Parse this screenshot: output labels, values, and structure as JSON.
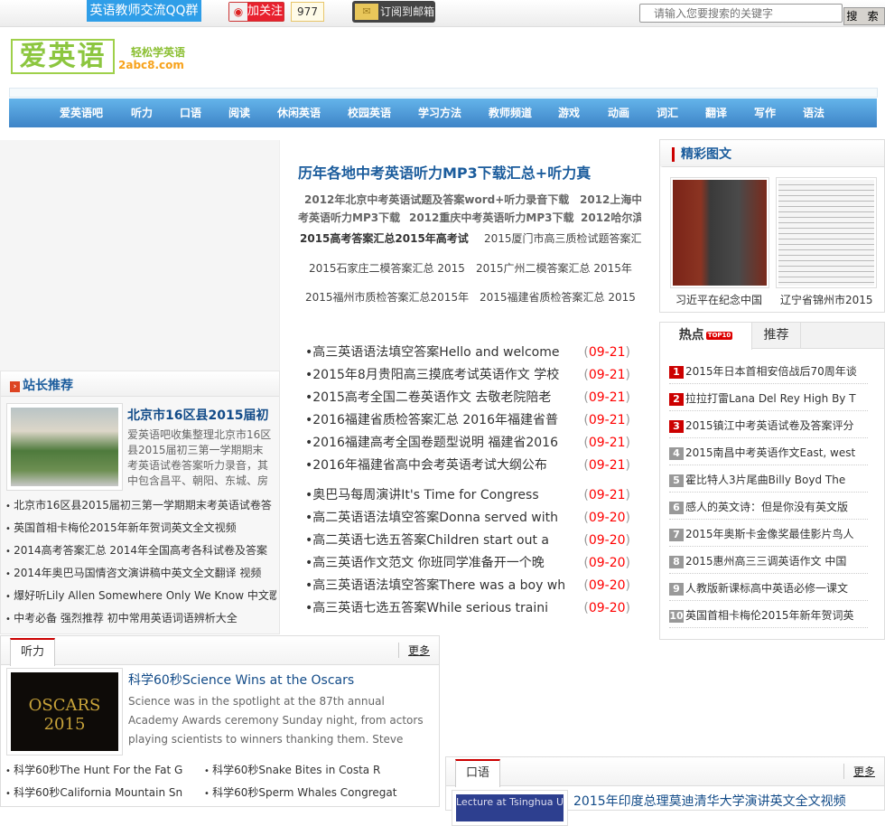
{
  "topbar": {
    "qq_group": "英语教师交流QQ群",
    "weibo_follow": "加关注",
    "weibo_count": "977",
    "subscribe_email": "订阅到邮箱",
    "search_placeholder": "请输入您要搜索的关键字",
    "search_button": "搜 索"
  },
  "logo": {
    "text": "爱英语",
    "slogan": "轻松学英语",
    "domain": "2abc8.com"
  },
  "nav": [
    "爱英语吧",
    "听力",
    "口语",
    "阅读",
    "休闲英语",
    "校园英语",
    "学习方法",
    "教师频道",
    "游戏",
    "动画",
    "词汇",
    "翻译",
    "写作",
    "语法"
  ],
  "headline": {
    "title": "历年各地中考英语听力MP3下载汇总+听力真",
    "links": [
      "2012年北京中考英语试题及答案word+听力录音下载",
      "2012上海中",
      "考英语听力MP3下载",
      "2012重庆中考英语听力MP3下载",
      "2012哈尔滨",
      "2015高考答案汇总2015年高考试",
      "2015厦门市高三质检试题答案汇",
      "2015石家庄二模答案汇总 2015",
      "2015广州二模答案汇总 2015年",
      "2015福州市质检答案汇总2015年",
      "2015福建省质检答案汇总 2015"
    ]
  },
  "news": [
    {
      "title": "高三英语语法填空答案Hello and welcome",
      "date": "09-21"
    },
    {
      "title": "2015年8月贵阳高三摸底考试英语作文 学校",
      "date": "09-21"
    },
    {
      "title": "2015高考全国二卷英语作文 去敬老院陪老",
      "date": "09-21"
    },
    {
      "title": "2016福建省质检答案汇总 2016年福建省普",
      "date": "09-21"
    },
    {
      "title": "2016福建高考全国卷题型说明 福建省2016",
      "date": "09-21"
    },
    {
      "title": "2016年福建省高中会考英语考试大纲公布",
      "date": "09-21"
    },
    {
      "title": "奥巴马每周演讲It's Time for Congress",
      "date": "09-21"
    },
    {
      "title": "高二英语语法填空答案Donna served with",
      "date": "09-20"
    },
    {
      "title": "高二英语七选五答案Children start out a",
      "date": "09-20"
    },
    {
      "title": "高三英语作文范文 你班同学准备开一个晚",
      "date": "09-20"
    },
    {
      "title": "高三英语语法填空答案There was a boy wh",
      "date": "09-20"
    },
    {
      "title": "高三英语七选五答案While serious traini",
      "date": "09-20"
    }
  ],
  "recommend": {
    "heading": "站长推荐",
    "feature_title": "北京市16区县2015届初",
    "feature_desc": "爱英语吧收集整理北京市16区县2015届初三第一学期期末考英语试卷答案听力录音，其中包含昌平、朝阳、东城、房",
    "items": [
      "北京市16区县2015届初三第一学期期末考英语试卷答",
      "英国首相卡梅伦2015年新年贺词英文全文视频",
      "2014高考答案汇总 2014年全国高考各科试卷及答案",
      "2014年奥巴马国情咨文演讲稿中英文全文翻译 视频",
      "爆好听Lily Allen Somewhere Only We Know 中文歌",
      "中考必备 强烈推荐 初中常用英语词语辨析大全"
    ]
  },
  "pictures": {
    "heading": "精彩图文",
    "items": [
      {
        "caption": "习近平在纪念中国"
      },
      {
        "caption": "辽宁省锦州市2015"
      }
    ]
  },
  "hot": {
    "tabs": [
      "热点",
      "推荐"
    ],
    "badge": "TOP10",
    "items": [
      "2015年日本首相安倍战后70周年谈",
      "拉拉打雷Lana Del Rey High By T",
      "2015镇江中考英语试卷及答案评分",
      "2015南昌中考英语作文East, west",
      "霍比特人3片尾曲Billy Boyd The",
      "感人的英文诗：但是你没有英文版",
      "2015年奥斯卡金像奖最佳影片鸟人",
      "2015惠州高三三调英语作文 中国",
      "人教版新课标高中英语必修一课文",
      "英国首相卡梅伦2015年新年贺词英"
    ]
  },
  "listening": {
    "tab": "听力",
    "more": "更多",
    "feature_title": "科学60秒Science Wins at the Oscars",
    "feature_desc": "Science was in the spotlight at the 87th annual Academy Awards ceremony Sunday night, from actors playing scientists to winners thanking them. Steve Mirsky repo...",
    "thumb_text": "OSCARS 2015",
    "items": [
      "科学60秒The Hunt For the Fat G",
      "科学60秒Snake Bites in Costa R",
      "科学60秒California Mountain Sn",
      "科学60秒Sperm Whales Congregat"
    ]
  },
  "speaking": {
    "tab": "口语",
    "more": "更多",
    "feature_title": "2015年印度总理莫迪清华大学演讲英文全文视频",
    "thumb_text": "Lecture at Tsinghua Uni"
  }
}
